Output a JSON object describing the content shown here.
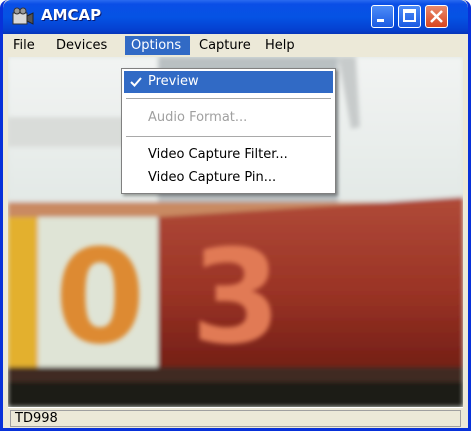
{
  "window": {
    "title": "AMCAP"
  },
  "menubar": {
    "items": [
      "File",
      "Devices",
      "Options",
      "Capture",
      "Help"
    ],
    "active": "Options"
  },
  "options_menu": {
    "items": [
      {
        "label": "Preview",
        "checked": true,
        "highlighted": true,
        "enabled": true
      },
      {
        "label": "Audio Format...",
        "checked": false,
        "highlighted": false,
        "enabled": false
      },
      {
        "label": "Video Capture Filter...",
        "checked": false,
        "highlighted": false,
        "enabled": true
      },
      {
        "label": "Video Capture Pin...",
        "checked": false,
        "highlighted": false,
        "enabled": true
      }
    ]
  },
  "video_preview": {
    "digits": [
      "0",
      "3"
    ]
  },
  "statusbar": {
    "text": "TD998"
  },
  "colors": {
    "titlebar": "#0553e4",
    "menu_highlight": "#316ac5",
    "close_button": "#d9451f"
  },
  "icons": [
    "camera-app-icon",
    "minimize-icon",
    "maximize-icon",
    "close-icon",
    "checkmark-icon"
  ]
}
